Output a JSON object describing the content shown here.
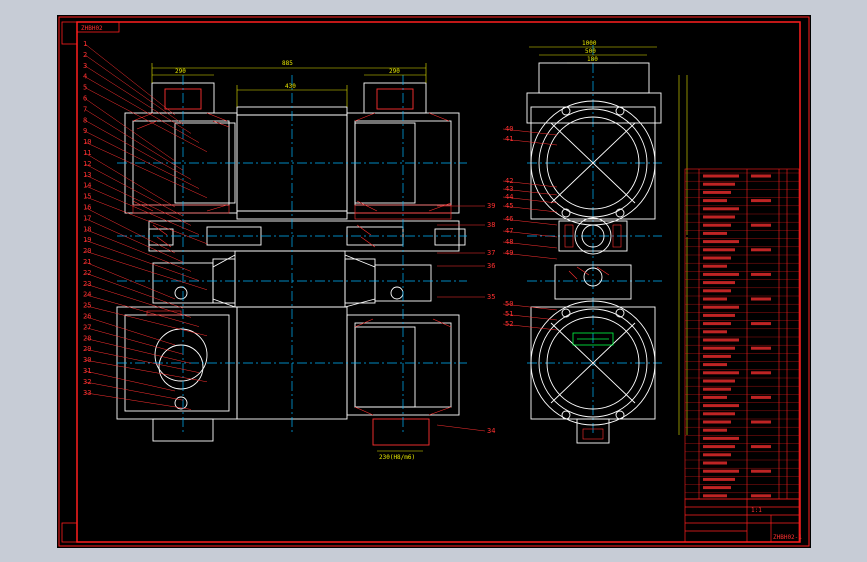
{
  "window": {
    "background_color": "#c7ccd6",
    "sheet_color": "#000000",
    "frame_color": "#ff1f1f",
    "outline_color": "#ffffff",
    "center_line_color": "#00b7ff",
    "dimension_color": "#e8e800",
    "hatch_color": "#ff3030",
    "highlight_color": "#00ff44"
  },
  "drawing": {
    "corner_code": "ZHBH02",
    "leader_labels_left": [
      "1",
      "2",
      "3",
      "4",
      "5",
      "6",
      "7",
      "8",
      "9",
      "10",
      "11",
      "12",
      "13",
      "14",
      "15",
      "16",
      "17",
      "18",
      "19",
      "20",
      "21",
      "22",
      "23",
      "24",
      "25",
      "26",
      "27",
      "28",
      "29",
      "30",
      "31",
      "32",
      "33"
    ],
    "leader_labels_right": [
      "34",
      "35",
      "36",
      "37",
      "38",
      "39"
    ],
    "leader_labels_side": [
      "40",
      "41",
      "42",
      "43",
      "44",
      "45",
      "46",
      "47",
      "48",
      "49",
      "50",
      "51",
      "52"
    ],
    "dimensions_top": [
      "885",
      "290",
      "290",
      "430"
    ],
    "dimensions_side": [
      "1000",
      "500",
      "180"
    ],
    "bottom_dimension": "230(H8/m6)",
    "title_block": {
      "scale": "1:1",
      "drawing_no": "ZHBH02-1"
    }
  }
}
